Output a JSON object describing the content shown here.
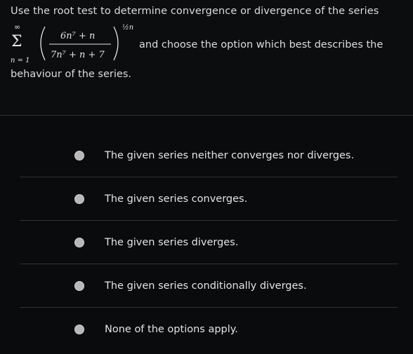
{
  "question": {
    "line1": "Use the root test to determine convergence or divergence of the series",
    "side_text": "and choose the option which best describes the",
    "line2": "behaviour of the series.",
    "formula": {
      "sum_top": "∞",
      "sum_bottom": "n = 1",
      "numerator": "6n⁷ + n",
      "denominator": "7n⁷ + n + 7",
      "exponent": "½n"
    }
  },
  "options": [
    {
      "label": "The given series neither converges nor diverges."
    },
    {
      "label": "The given series converges."
    },
    {
      "label": "The given series diverges."
    },
    {
      "label": "The given series conditionally diverges."
    },
    {
      "label": "None of the options apply."
    }
  ]
}
